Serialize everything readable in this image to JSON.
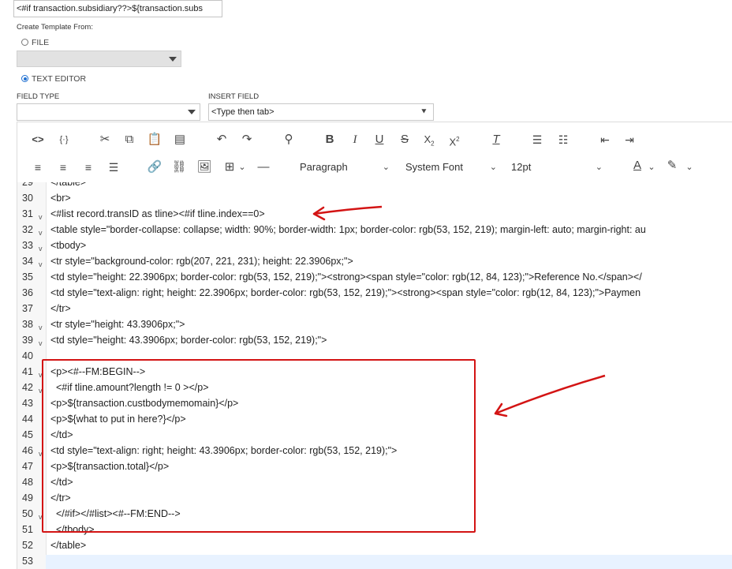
{
  "top_input": {
    "value": "<#if transaction.subsidiary??>${transaction.subs"
  },
  "template_source": {
    "label": "Create Template From:",
    "file_label": "FILE",
    "text_editor_label": "TEXT EDITOR",
    "selected": "TEXT EDITOR"
  },
  "field_type": {
    "label": "FIELD TYPE",
    "value": ""
  },
  "insert_field": {
    "label": "INSERT FIELD",
    "value": "<Type then tab>"
  },
  "toolbar": {
    "row1_icons": [
      "source-code-icon",
      "template-var-icon",
      "cut-icon",
      "copy-icon",
      "paste-icon",
      "paste-text-icon",
      "undo-icon",
      "redo-icon",
      "find-icon",
      "bold-icon",
      "italic-icon",
      "underline-icon",
      "strikethrough-icon",
      "subscript-icon",
      "superscript-icon",
      "clear-format-icon",
      "numbered-list-icon",
      "bullet-list-icon",
      "outdent-icon",
      "indent-icon"
    ],
    "block_format": "Paragraph",
    "font_family": "System Font",
    "font_size": "12pt"
  },
  "editor": {
    "lines": [
      {
        "n": "29",
        "text": "</table>",
        "fold": false
      },
      {
        "n": "30",
        "text": "<br>",
        "fold": false
      },
      {
        "n": "31",
        "text": "<#list record.transID as tline><#if tline.index==0>",
        "fold": true
      },
      {
        "n": "32",
        "text": "<table style=\"border-collapse: collapse; width: 90%; border-width: 1px; border-color: rgb(53, 152, 219); margin-left: auto; margin-right: au",
        "fold": true
      },
      {
        "n": "33",
        "text": "<tbody>",
        "fold": true
      },
      {
        "n": "34",
        "text": "<tr style=\"background-color: rgb(207, 221, 231); height: 22.3906px;\">",
        "fold": true
      },
      {
        "n": "35",
        "text": "<td style=\"height: 22.3906px; border-color: rgb(53, 152, 219);\"><strong><span style=\"color: rgb(12, 84, 123);\">Reference No.</span></",
        "fold": false
      },
      {
        "n": "36",
        "text": "<td style=\"text-align: right; height: 22.3906px; border-color: rgb(53, 152, 219);\"><strong><span style=\"color: rgb(12, 84, 123);\">Paymen",
        "fold": false
      },
      {
        "n": "37",
        "text": "</tr>",
        "fold": false
      },
      {
        "n": "38",
        "text": "<tr style=\"height: 43.3906px;\">",
        "fold": true
      },
      {
        "n": "39",
        "text": "<td style=\"height: 43.3906px; border-color: rgb(53, 152, 219);\">",
        "fold": true
      },
      {
        "n": "40",
        "text": "",
        "fold": false
      },
      {
        "n": "41",
        "text": "<p><#--FM:BEGIN-->",
        "fold": true
      },
      {
        "n": "42",
        "text": "  <#if tline.amount?length != 0 ></p>",
        "fold": true
      },
      {
        "n": "43",
        "text": "<p>${transaction.custbodymemomain}</p>",
        "fold": false
      },
      {
        "n": "44",
        "text": "<p>${what to put in here?}</p>",
        "fold": false
      },
      {
        "n": "45",
        "text": "</td>",
        "fold": false
      },
      {
        "n": "46",
        "text": "<td style=\"text-align: right; height: 43.3906px; border-color: rgb(53, 152, 219);\">",
        "fold": true
      },
      {
        "n": "47",
        "text": "<p>${transaction.total}</p>",
        "fold": false
      },
      {
        "n": "48",
        "text": "</td>",
        "fold": false
      },
      {
        "n": "49",
        "text": "</tr>",
        "fold": false
      },
      {
        "n": "50",
        "text": "  </#if></#list><#--FM:END-->",
        "fold": true
      },
      {
        "n": "51",
        "text": "  </tbody>",
        "fold": false
      },
      {
        "n": "52",
        "text": "</table>",
        "fold": false
      },
      {
        "n": "53",
        "text": "",
        "fold": false
      }
    ]
  },
  "colors": {
    "annotation_red": "#d31414",
    "accent_blue": "#1f6fd1"
  }
}
